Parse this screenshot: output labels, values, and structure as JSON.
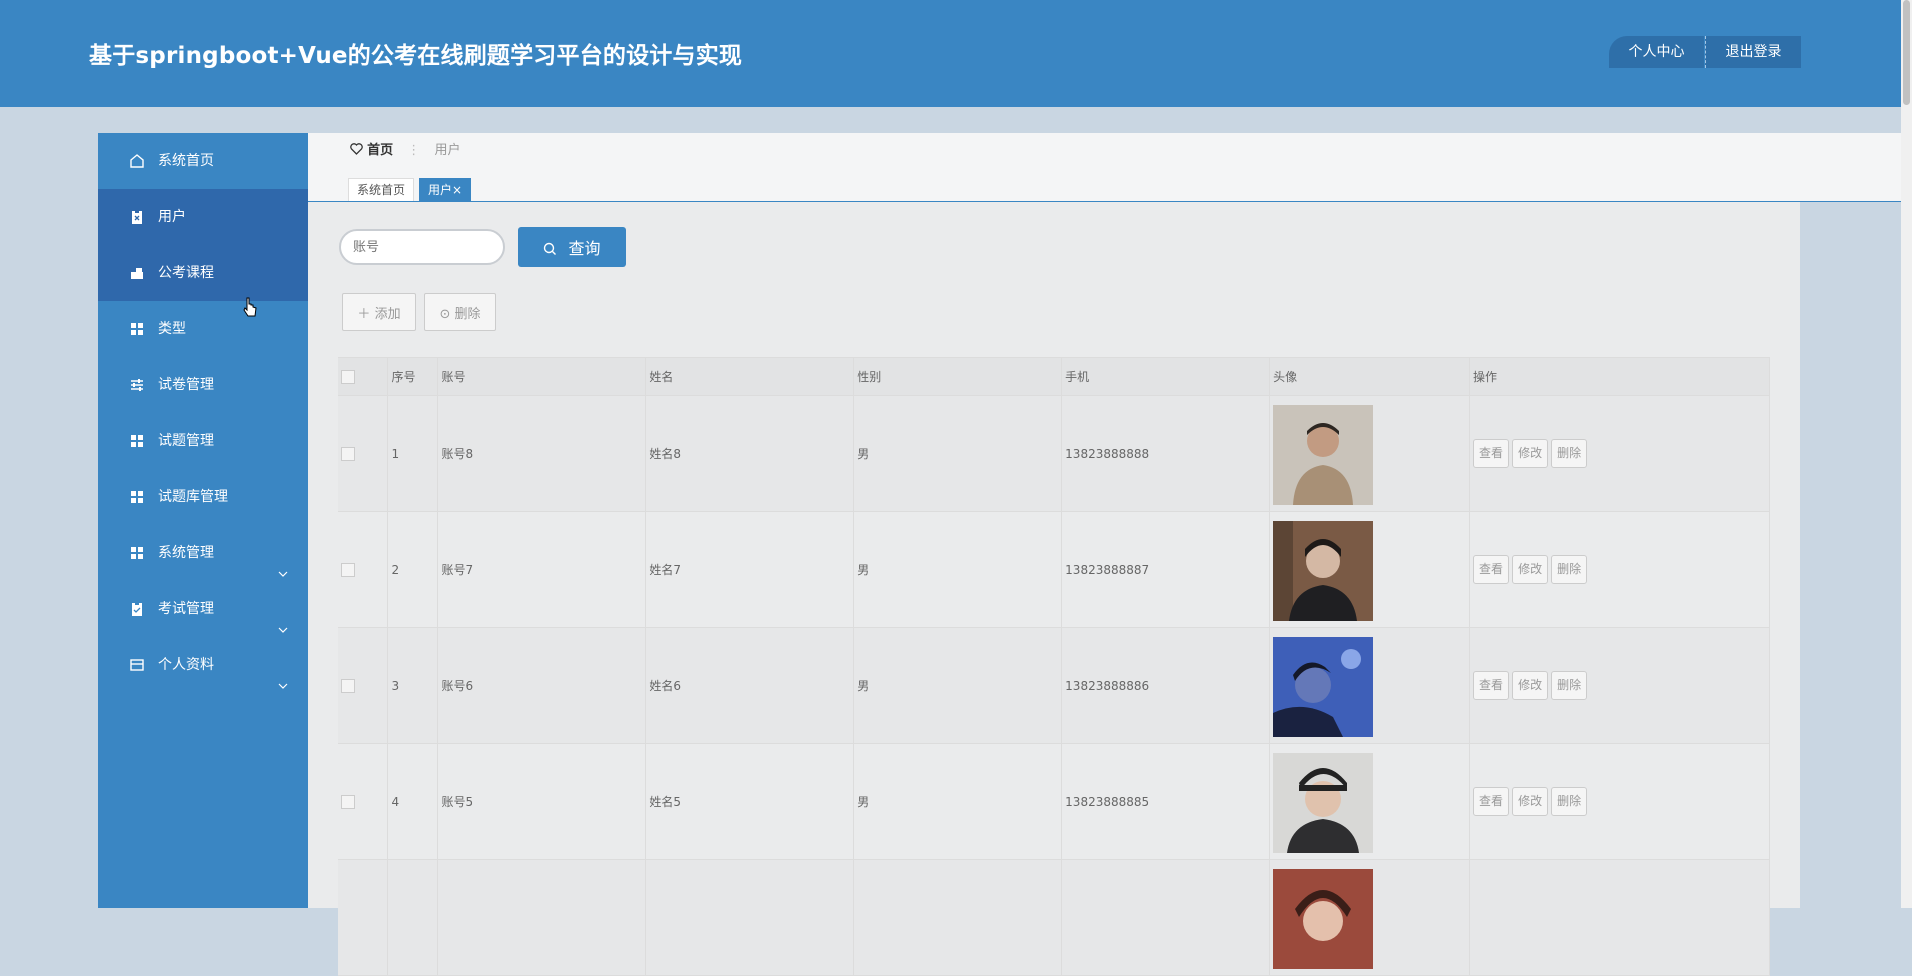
{
  "header": {
    "title": "基于springboot+Vue的公考在线刷题学习平台的设计与实现",
    "profile_label": "个人中心",
    "logout_label": "退出登录"
  },
  "sidebar": {
    "items": [
      {
        "label": "系统首页",
        "icon": "home-icon"
      },
      {
        "label": "用户",
        "icon": "clipboard-icon"
      },
      {
        "label": "公考课程",
        "icon": "bag-icon"
      },
      {
        "label": "类型",
        "icon": "grid-icon"
      },
      {
        "label": "试卷管理",
        "icon": "sliders-icon"
      },
      {
        "label": "试题管理",
        "icon": "grid-icon"
      },
      {
        "label": "试题库管理",
        "icon": "grid-icon"
      },
      {
        "label": "系统管理",
        "icon": "grid-icon",
        "expandable": true
      },
      {
        "label": "考试管理",
        "icon": "clipboard-icon",
        "expandable": true
      },
      {
        "label": "个人资料",
        "icon": "card-icon",
        "expandable": true
      }
    ]
  },
  "breadcrumb": {
    "home": "首页",
    "current": "用户"
  },
  "tabs": {
    "home": "系统首页",
    "user": "用户",
    "close_glyph": "×"
  },
  "search": {
    "placeholder": "账号",
    "button_label": "查询"
  },
  "actions": {
    "add_label": "添加",
    "delete_label": "删除"
  },
  "table": {
    "headers": [
      "序号",
      "账号",
      "姓名",
      "性别",
      "手机",
      "头像",
      "操作"
    ],
    "rows": [
      {
        "index": "1",
        "account": "账号8",
        "name": "姓名8",
        "gender": "男",
        "phone": "13823888888"
      },
      {
        "index": "2",
        "account": "账号7",
        "name": "姓名7",
        "gender": "男",
        "phone": "13823888887"
      },
      {
        "index": "3",
        "account": "账号6",
        "name": "姓名6",
        "gender": "男",
        "phone": "13823888886"
      },
      {
        "index": "4",
        "account": "账号5",
        "name": "姓名5",
        "gender": "男",
        "phone": "13823888885"
      }
    ],
    "op_labels": {
      "view": "查看",
      "edit": "修改",
      "delete": "删除"
    }
  },
  "colors": {
    "primary": "#3a86c3",
    "sidebar_active": "#2f68ab",
    "page_bg": "#c9d6e2"
  }
}
